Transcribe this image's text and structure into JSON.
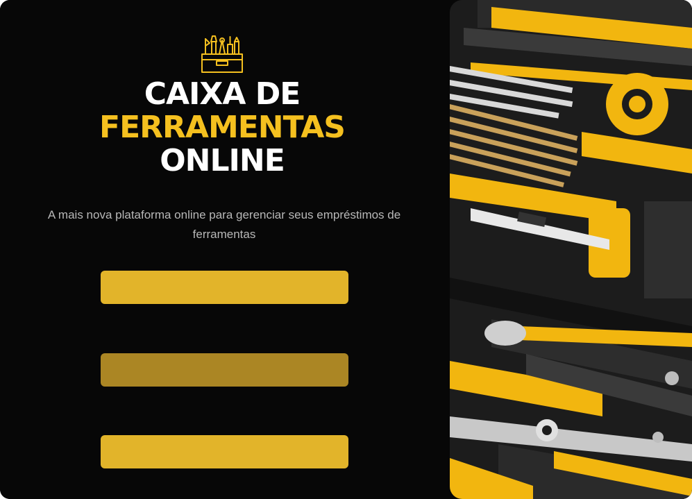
{
  "hero": {
    "logo_icon": "toolbox-icon",
    "title_line1": "CAIXA DE",
    "title_line2": "FERRAMENTAS",
    "title_line3": "ONLINE",
    "subtitle": "A mais nova plataforma online para gerenciar seus empréstimos de ferramentas"
  },
  "actions": {
    "button1_label": "",
    "button2_label": "",
    "button3_label": ""
  },
  "image": {
    "icon": "tools-photo"
  },
  "colors": {
    "background": "#070707",
    "accent": "#f5c01f",
    "button": "#e2b42a",
    "button_hover": "#ab8624",
    "text_muted": "#b8b8b8"
  }
}
